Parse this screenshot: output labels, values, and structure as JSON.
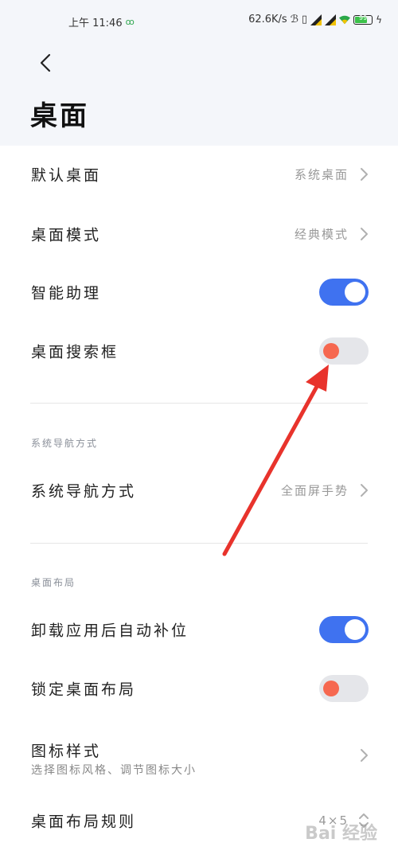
{
  "status_bar": {
    "time": "上午 11:46",
    "speed": "62.6K/s",
    "battery": "99"
  },
  "page": {
    "title": "桌面"
  },
  "items": [
    {
      "label": "默认桌面",
      "value": "系统桌面"
    },
    {
      "label": "桌面模式",
      "value": "经典模式"
    },
    {
      "label": "智能助理",
      "toggle": true
    },
    {
      "label": "桌面搜索框",
      "toggle": false
    }
  ],
  "nav_section": {
    "header": "系统导航方式",
    "item": {
      "label": "系统导航方式",
      "value": "全面屏手势"
    }
  },
  "layout_section": {
    "header": "桌面布局",
    "items": [
      {
        "label": "卸载应用后自动补位",
        "toggle": true
      },
      {
        "label": "锁定桌面布局",
        "toggle": false
      },
      {
        "label": "图标样式",
        "sub": "选择图标风格、调节图标大小"
      },
      {
        "label": "桌面布局规则",
        "value": "4×5"
      }
    ]
  },
  "colors": {
    "accent": "#3f72f0",
    "toggle_off_knob": "#f66850",
    "arrow": "#e8332c"
  },
  "watermark": "Bai 经验"
}
